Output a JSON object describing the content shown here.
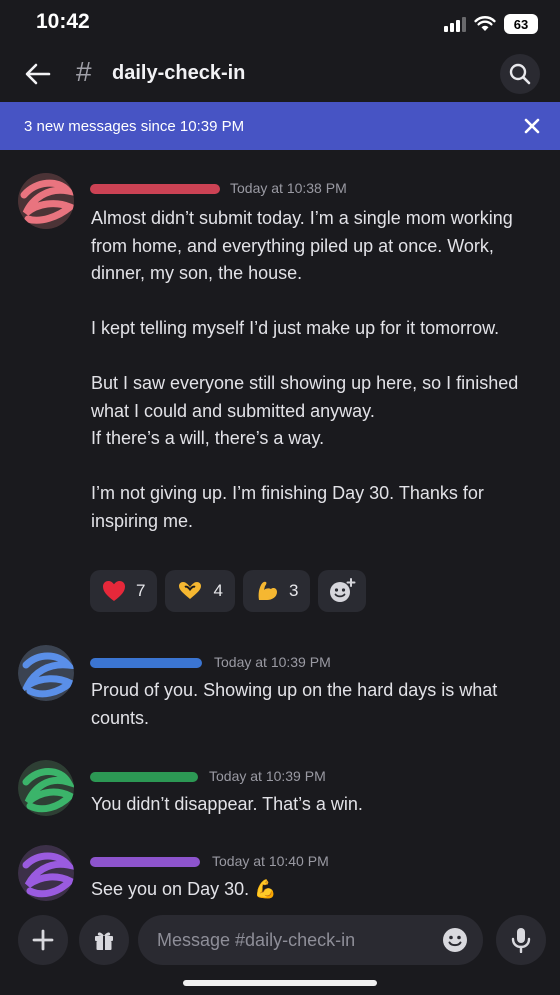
{
  "status_bar": {
    "time": "10:42",
    "battery": "63"
  },
  "header": {
    "hash": "#",
    "channel_name": "daily-check-in"
  },
  "banner": {
    "text": "3 new messages since 10:39 PM"
  },
  "messages": [
    {
      "timestamp": "Today at 10:38 PM",
      "name_color": "#e0475a",
      "text": "Almost didn’t submit today. I’m a single mom working from home, and everything piled up at once. Work, dinner, my son, the house.\n\nI kept telling myself I’d just make up for it tomorrow.\n\nBut I saw everyone still showing up here, so I finished what I could and submitted anyway.\nIf there’s a will, there’s a way.\n\nI’m not giving up. I’m finishing Day 30. Thanks for inspiring me.",
      "reactions": [
        {
          "icon": "heart-icon",
          "count": "7"
        },
        {
          "icon": "heart-hands-icon",
          "count": "4"
        },
        {
          "icon": "flexed-biceps-icon",
          "count": "3"
        }
      ]
    },
    {
      "timestamp": "Today at 10:39 PM",
      "name_color": "#3f7fe6",
      "text": "Proud of you. Showing up on the hard days is what counts."
    },
    {
      "timestamp": "Today at 10:39 PM",
      "name_color": "#2fa65a",
      "text": "You didn’t disappear. That’s a win."
    },
    {
      "timestamp": "Today at 10:40 PM",
      "name_color": "#9a5be0",
      "text": "See you on Day 30. 💪"
    }
  ],
  "composer": {
    "placeholder": "Message #daily-check-in"
  },
  "colors": {
    "background": "#1a1a1e",
    "banner": "#4754c4",
    "chip": "#2a2b32"
  }
}
